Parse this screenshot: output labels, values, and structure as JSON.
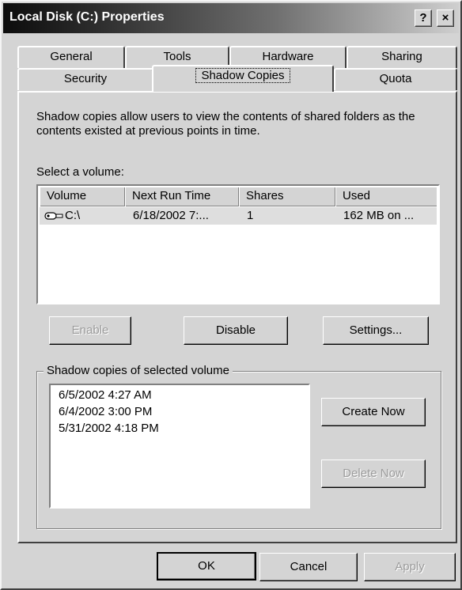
{
  "window": {
    "title": "Local Disk (C:) Properties",
    "help_button": "?",
    "close_button": "×"
  },
  "tabs": {
    "row1": [
      "General",
      "Tools",
      "Hardware",
      "Sharing"
    ],
    "row2": [
      "Security",
      "Shadow Copies",
      "Quota"
    ],
    "active": "Shadow Copies"
  },
  "content": {
    "description": "Shadow copies allow users to view the contents of shared folders as the contents existed at previous points in time.",
    "select_volume_label": "Select a volume:",
    "volume_columns": [
      "Volume",
      "Next Run Time",
      "Shares",
      "Used"
    ],
    "volumes": [
      {
        "volume": "C:\\",
        "next_run": "6/18/2002 7:...",
        "shares": "1",
        "used": "162 MB on ..."
      }
    ],
    "enable_button": "Enable",
    "disable_button": "Disable",
    "settings_button": "Settings...",
    "group_title": "Shadow copies of selected volume",
    "shadow_copies": [
      "6/5/2002 4:27 AM",
      "6/4/2002 3:00 PM",
      "5/31/2002 4:18 PM"
    ],
    "create_now_button": "Create Now",
    "delete_now_button": "Delete Now"
  },
  "footer": {
    "ok_button": "OK",
    "cancel_button": "Cancel",
    "apply_button": "Apply"
  },
  "colors": {
    "face": "#d4d4d4",
    "disabled_text": "#9c9c9c"
  }
}
